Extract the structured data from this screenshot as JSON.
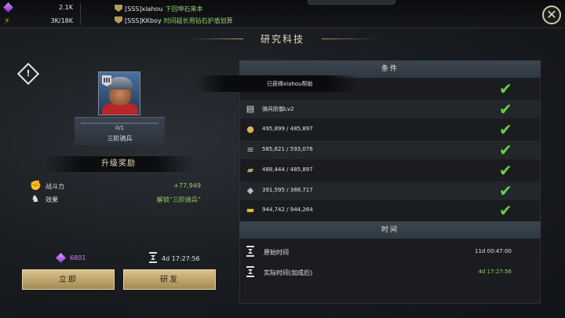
{
  "resources": {
    "gems": "2.1K",
    "energy": "3K/18K"
  },
  "chat": [
    {
      "name": "[SSS]xiahou",
      "message": "下回坤石来本"
    },
    {
      "name": "[SSS]KKboy",
      "message": "时间超长用钻石护盾划算"
    }
  ],
  "title": "研究科技",
  "unit": {
    "rank": "III",
    "progress": "0/1",
    "name": "三阶骑兵"
  },
  "reward": {
    "header": "升级奖励",
    "rows": [
      {
        "icon": "fist-icon",
        "label": "战斗力",
        "value": "+77,949"
      },
      {
        "icon": "cavalry-icon",
        "label": "效果",
        "value": "解锁“三阶骑兵”"
      }
    ]
  },
  "cost": {
    "gems": "6801",
    "time": "4d  17:27:56"
  },
  "buttons": {
    "instant": "立即",
    "research": "研发"
  },
  "conditions": {
    "header": "条件",
    "tooltip": "已获得xiahou帮助",
    "rows": [
      {
        "icon": "trophy-icon",
        "text": ""
      },
      {
        "icon": "book-icon",
        "text": "骑兵防御Lv2"
      },
      {
        "icon": "food-icon",
        "text": "495,899 / 485,897"
      },
      {
        "icon": "wood-icon",
        "text": "585,621 / 593,076"
      },
      {
        "icon": "stone-icon",
        "text": "488,444 / 485,897"
      },
      {
        "icon": "iron-icon",
        "text": "391,595 / 388,717"
      },
      {
        "icon": "gold-icon",
        "text": "944,742 / 944,264"
      }
    ]
  },
  "time": {
    "header": "时间",
    "original_label": "原始时间",
    "original_value": "11d  00:47:00",
    "actual_label": "实际时间(加成后)",
    "actual_value": "4d  17:27:56"
  },
  "colors": {
    "accent_gold": "#d9c28e",
    "success_green": "#8fd26a",
    "gem_purple": "#d87dff"
  }
}
